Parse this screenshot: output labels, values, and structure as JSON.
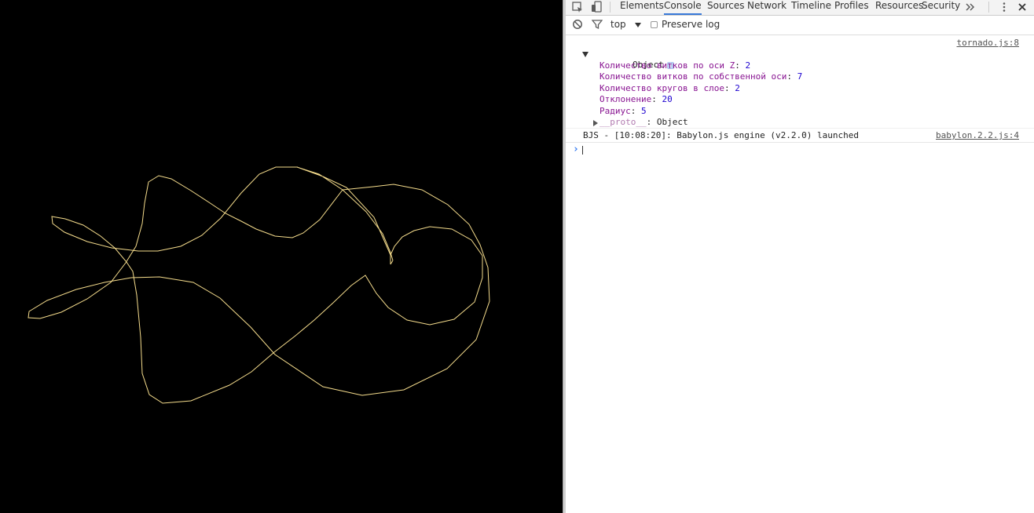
{
  "devtools": {
    "tabs": [
      {
        "label": "Elements",
        "active": false
      },
      {
        "label": "Console",
        "active": true
      },
      {
        "label": "Sources",
        "active": false
      },
      {
        "label": "Network",
        "active": false
      },
      {
        "label": "Timeline",
        "active": false
      },
      {
        "label": "Profiles",
        "active": false
      },
      {
        "label": "Resources",
        "active": false
      },
      {
        "label": "Security",
        "active": false
      }
    ],
    "more_tabs_icon": "double-chevron-icon",
    "menu_icon": "vertical-dots-icon",
    "close_icon": "close-icon",
    "accent_color": "#3879d9"
  },
  "filterbar": {
    "context": "top",
    "preserve_log_label": "Preserve log",
    "preserve_log_checked": false
  },
  "console": {
    "object_log": {
      "source": "tornado.js:8",
      "label": "Object",
      "props": [
        {
          "name": "Количество витков по оси Z",
          "value": "2"
        },
        {
          "name": "Количество витков по собственной оси",
          "value": "7"
        },
        {
          "name": "Количество кругов в слое",
          "value": "2"
        },
        {
          "name": "Отклонение",
          "value": "20"
        },
        {
          "name": "Радиус",
          "value": "5"
        }
      ],
      "proto_name": "__proto__",
      "proto_value": "Object"
    },
    "engine_log": {
      "text": "BJS - [10:08:20]: Babylon.js engine (v2.2.0) launched",
      "source": "babylon.2.2.js:4"
    },
    "prompt_symbol": "›"
  },
  "scene": {
    "background": "#000000",
    "line_color": "#f5dc8c"
  }
}
